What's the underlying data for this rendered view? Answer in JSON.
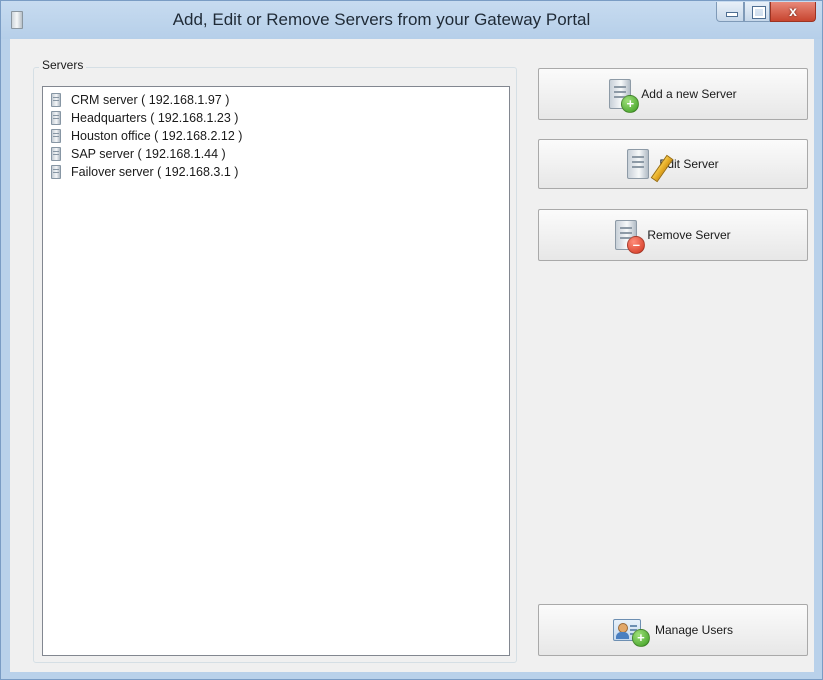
{
  "window": {
    "title": "Add, Edit or Remove Servers from your Gateway Portal",
    "close_glyph": "x"
  },
  "servers_group": {
    "label": "Servers",
    "items": [
      {
        "label": "CRM server ( 192.168.1.97 )",
        "icon": "server-icon"
      },
      {
        "label": "Headquarters ( 192.168.1.23 )",
        "icon": "server-icon"
      },
      {
        "label": "Houston office ( 192.168.2.12 )",
        "icon": "server-icon"
      },
      {
        "label": "SAP server ( 192.168.1.44 )",
        "icon": "server-icon"
      },
      {
        "label": "Failover server ( 192.168.3.1 )",
        "icon": "server-icon"
      }
    ]
  },
  "actions": {
    "add_label": "Add a new Server",
    "edit_label": "Edit Server",
    "remove_label": "Remove Server",
    "manage_users_label": "Manage Users"
  },
  "colors": {
    "add_badge": "#3a9c1e",
    "remove_badge": "#d0321c",
    "close_button": "#c7452f"
  }
}
